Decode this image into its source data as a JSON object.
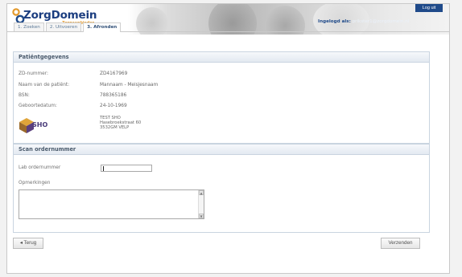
{
  "header": {
    "logo_title": "ZorgDomein",
    "logo_subtitle": "Zorgaanbieder",
    "logout_label": "Log uit",
    "login_prefix": "Ingelogd als:",
    "login_user": "prikster1@zorgdomein.nl",
    "tabs": [
      {
        "label": "1. Zoeken"
      },
      {
        "label": "2. Uitvoeren"
      },
      {
        "label": "3. Afronden"
      }
    ]
  },
  "patient": {
    "section_title": "Patiëntgegevens",
    "fields": [
      {
        "label": "ZD-nummer:",
        "value": "ZD4167969"
      },
      {
        "label": "Naam van de patiënt:",
        "value": "Mannaam - Meisjesnaam"
      },
      {
        "label": "BSN:",
        "value": "788365186"
      },
      {
        "label": "Geboortedatum:",
        "value": "24-10-1969"
      }
    ],
    "org_logo": "SHO",
    "address": [
      "TEST SHO",
      "Hasebroekstraat 60",
      "3532GM VELP"
    ]
  },
  "scan": {
    "section_title": "Scan ordernummer",
    "lab_label": "Lab ordernummer",
    "lab_value": "",
    "remarks_label": "Opmerkingen",
    "remarks_value": ""
  },
  "footer": {
    "back_label": "◂ Terug",
    "send_label": "Verzenden"
  }
}
